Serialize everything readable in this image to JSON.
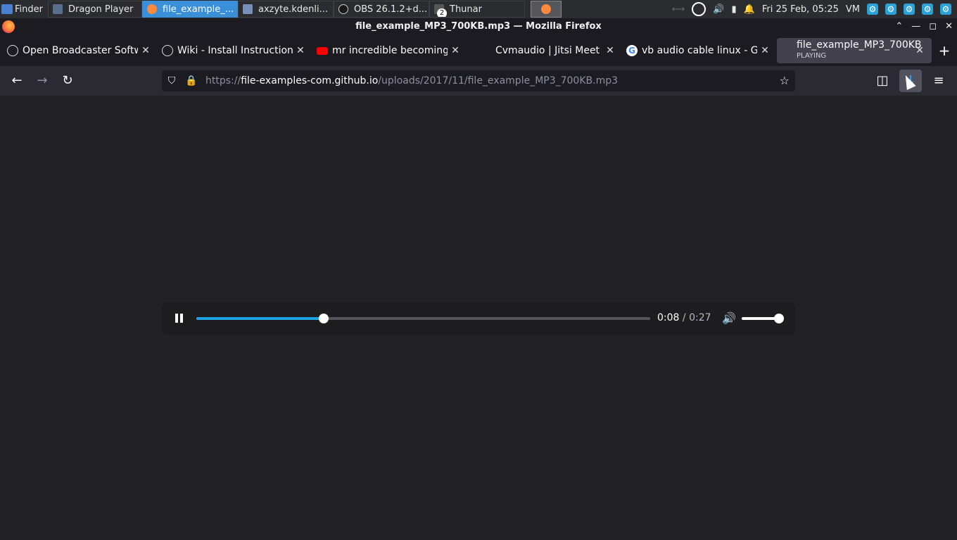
{
  "taskbar": {
    "start_label": "Finder",
    "tasks": [
      {
        "label": "Dragon Player",
        "active": false
      },
      {
        "label": "file_example_...",
        "active": true
      },
      {
        "label": "axzyte.kdenli...",
        "active": false
      },
      {
        "label": "OBS 26.1.2+d...",
        "active": false
      },
      {
        "label": "Thunar",
        "active": false
      }
    ],
    "badge": "2",
    "clock": "Fri 25 Feb, 05:25",
    "keyboard_layout": "VM"
  },
  "window": {
    "title": "file_example_MP3_700KB.mp3 — Mozilla Firefox"
  },
  "tabs": [
    {
      "title": "Open Broadcaster Software",
      "icon": "obs-icon"
    },
    {
      "title": "Wiki - Install Instructions",
      "icon": "obs-icon"
    },
    {
      "title": "mr incredible becoming",
      "icon": "youtube-icon"
    },
    {
      "title": "Cvmaudio | Jitsi Meet",
      "icon": "jitsi-icon"
    },
    {
      "title": "vb audio cable linux - Google",
      "icon": "google-icon"
    },
    {
      "title": "file_example_MP3_700KB",
      "subtitle": "PLAYING",
      "icon": "audio-icon",
      "selected": true
    }
  ],
  "urlbar": {
    "scheme": "https://",
    "host": "file-examples-com.github.io",
    "path": "/uploads/2017/11/file_example_MP3_700KB.mp3"
  },
  "player": {
    "current_time": "0:08",
    "separator": " / ",
    "duration": "0:27",
    "progress_fraction": 0.28,
    "volume_fraction": 1.0
  },
  "colors": {
    "accent": "#1fa3e6",
    "background": "#222224",
    "taskbar_active": "#3a8fd9"
  }
}
